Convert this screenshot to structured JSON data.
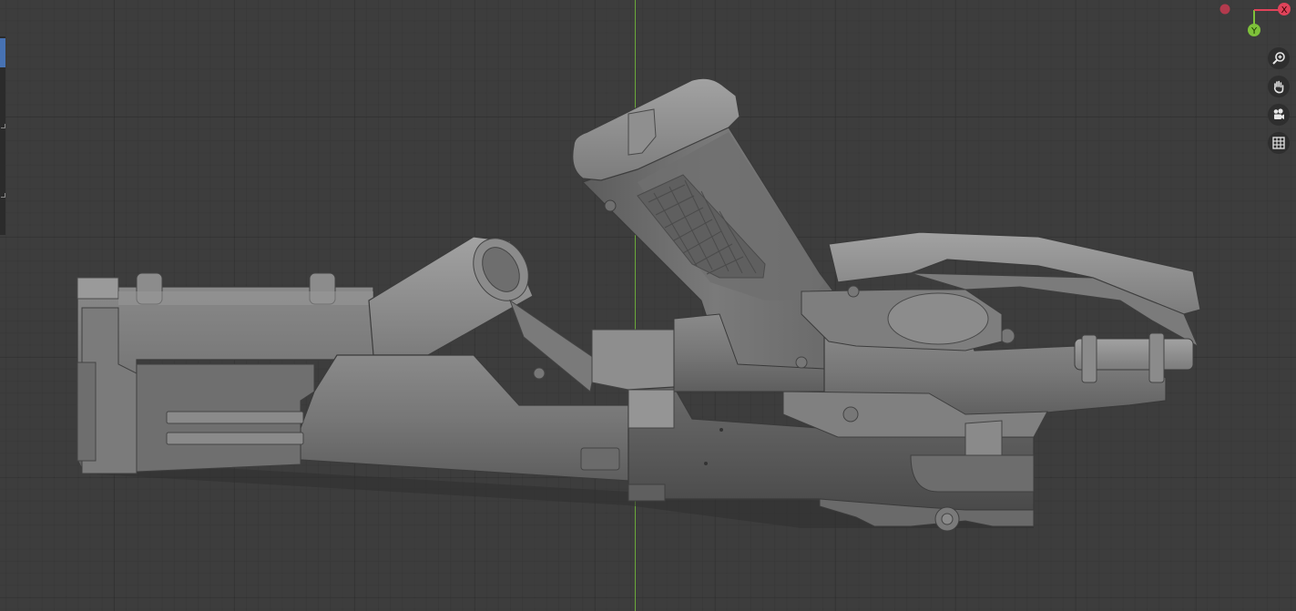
{
  "viewport": {
    "header_text": "·· ·· ··· ····",
    "gizmo": {
      "x_label": "X",
      "y_label": "Y",
      "x_color": "#e0435a",
      "y_color": "#7ec13a",
      "neg_x_color": "#b33a4d"
    },
    "nav_controls": [
      {
        "name": "zoom",
        "icon": "magnifier-plus-icon"
      },
      {
        "name": "pan",
        "icon": "hand-icon"
      },
      {
        "name": "camera",
        "icon": "camera-icon"
      },
      {
        "name": "perspective",
        "icon": "grid-icon"
      }
    ],
    "colors": {
      "background": "#3d3d3d",
      "axis_y_line": "#6aa83a",
      "toolbar": "#2b2b2b",
      "active_tool": "#4772b3"
    },
    "model": {
      "shading": "solid",
      "object": "sci-fi rifle hard-surface mesh"
    }
  }
}
